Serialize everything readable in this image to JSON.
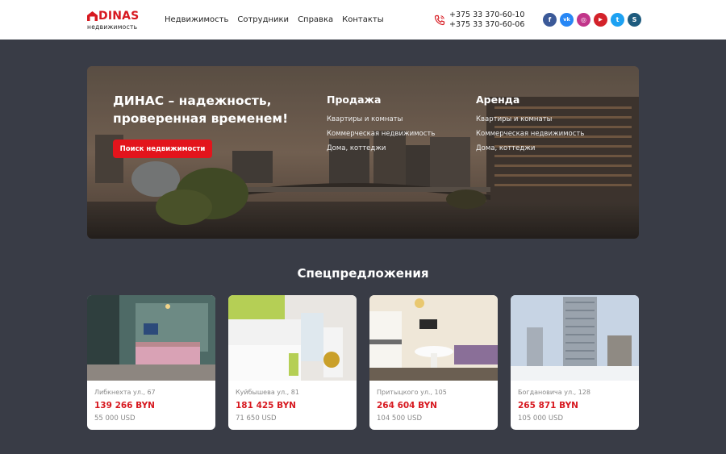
{
  "header": {
    "logo_brand": "DINAS",
    "logo_sub": "недвижимость",
    "nav": [
      "Недвижимость",
      "Сотрудники",
      "Справка",
      "Контакты"
    ],
    "phones": [
      "+375 33 370-60-10",
      "+375 33 370-60-06"
    ],
    "socials": [
      {
        "icon": "facebook-icon",
        "glyph": "f",
        "color": "#3b5998"
      },
      {
        "icon": "vk-icon",
        "glyph": "vk",
        "color": "#2787f5"
      },
      {
        "icon": "instagram-icon",
        "glyph": "◎",
        "color": "#c1358a"
      },
      {
        "icon": "youtube-icon",
        "glyph": "▶",
        "color": "#d3222a"
      },
      {
        "icon": "twitter-icon",
        "glyph": "t",
        "color": "#1da1f2"
      },
      {
        "icon": "skype-icon",
        "glyph": "S",
        "color": "#1e5b7e"
      }
    ]
  },
  "hero": {
    "title": "ДИНАС – надежность, проверенная временем!",
    "button": "Поиск недвижимости",
    "sale": {
      "title": "Продажа",
      "links": [
        "Квартиры и комнаты",
        "Коммерческая недвижимость",
        "Дома, коттеджи"
      ]
    },
    "rent": {
      "title": "Аренда",
      "links": [
        "Квартиры и комнаты",
        "Коммерческая недвижимость",
        "Дома, коттеджи"
      ]
    }
  },
  "offers": {
    "title": "Спецпредложения",
    "items": [
      {
        "address": "Либкнехта ул., 67",
        "price": "139 266 BYN",
        "usd": "55 000 USD"
      },
      {
        "address": "Куйбышева ул., 81",
        "price": "181 425 BYN",
        "usd": "71 650 USD"
      },
      {
        "address": "Притыцкого ул., 105",
        "price": "264 604 BYN",
        "usd": "104 500 USD"
      },
      {
        "address": "Богдановича ул., 128",
        "price": "265 871 BYN",
        "usd": "105 000 USD"
      }
    ]
  },
  "colors": {
    "accent": "#e3141c",
    "page_bg": "#393c46",
    "header_bg": "#ffffff"
  }
}
